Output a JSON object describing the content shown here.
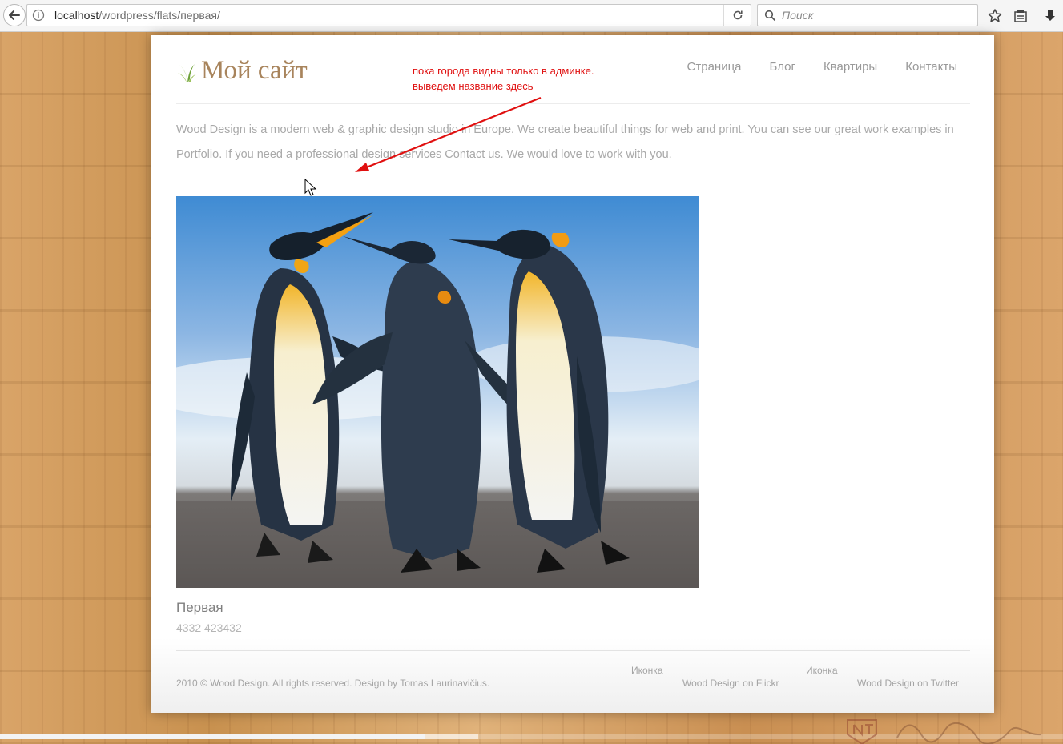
{
  "browser": {
    "url_host": "localhost",
    "url_path": "/wordpress/flats/первая/",
    "search_placeholder": "Поиск"
  },
  "site": {
    "logo_text": "Мой сайт",
    "nav": [
      "Страница",
      "Блог",
      "Квартиры",
      "Контакты"
    ],
    "intro": "Wood Design is a modern web & graphic design studio in Europe. We create beautiful things for web and print. You can see our great work examples in Portfolio. If you need a professional design services Contact us. We would love to work with you."
  },
  "annotation": {
    "line1": "пока города видны только в админке.",
    "line2": "выведем название здесь",
    "color": "#e01010"
  },
  "post": {
    "title": "Первая",
    "meta": "4332 423432",
    "image": "penguins-photo"
  },
  "footer": {
    "copyright": "2010 © Wood Design. All rights reserved. Design by Tomas Laurinavičius.",
    "links": [
      {
        "icon_alt": "Иконка",
        "label": "Wood Design on Flickr"
      },
      {
        "icon_alt": "Иконка",
        "label": "Wood Design on Twitter"
      }
    ]
  },
  "video": {
    "progress": 0.4,
    "buffered": 0.45
  }
}
